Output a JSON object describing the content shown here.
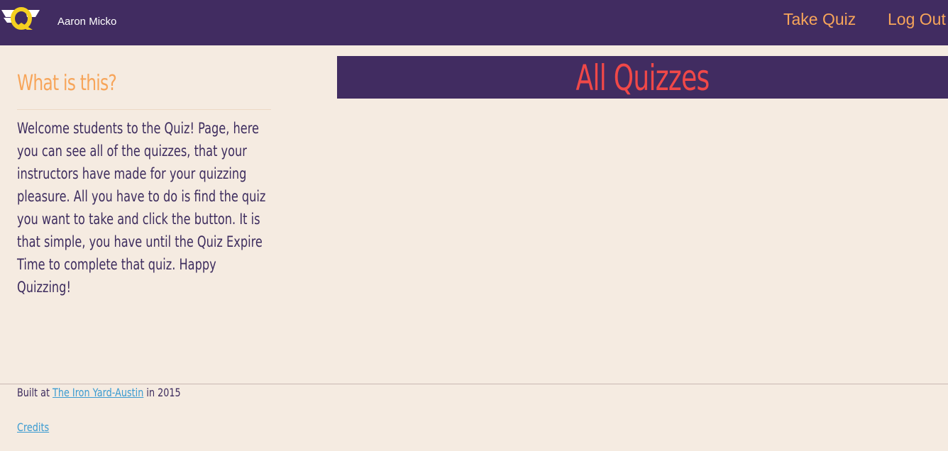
{
  "header": {
    "user_name": "Aaron Micko",
    "nav": {
      "take_quiz": "Take Quiz",
      "log_out": "Log Out"
    },
    "logo_icon": "q-logo-icon"
  },
  "sidebar": {
    "title": "What is this?",
    "description": "Welcome students to the Quiz! Page, here you can see all of the quizzes, that your instructors have made for your quizzing pleasure. All you have to do is find the quiz you want to take and click the button. It is that simple, you have until the Quiz Expire Time to complete that quiz. Happy Quizzing!"
  },
  "main": {
    "title": "All Quizzes"
  },
  "footer": {
    "built_prefix": "Built at",
    "built_link": "The Iron Yard-Austin",
    "built_suffix": "in 2015",
    "credits": "Credits"
  },
  "colors": {
    "bar": "#412c61",
    "accent_orange": "#f7a55a",
    "title_red": "#f04848",
    "background": "#f5ebe1",
    "link_blue": "#3a9bd1"
  }
}
